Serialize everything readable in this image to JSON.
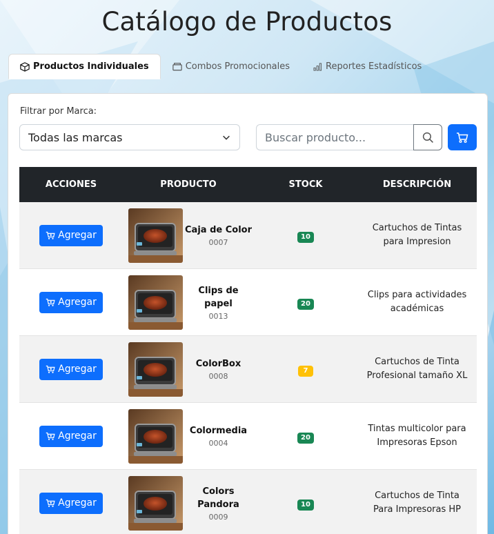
{
  "page": {
    "title": "Catálogo de Productos"
  },
  "tabs": [
    {
      "label": "Productos Individuales",
      "icon": "box-icon",
      "active": true
    },
    {
      "label": "Combos Promocionales",
      "icon": "gift-box-icon",
      "active": false
    },
    {
      "label": "Reportes Estadísticos",
      "icon": "bar-chart-icon",
      "active": false
    }
  ],
  "filter": {
    "label": "Filtrar por Marca:",
    "selected": "Todas las marcas"
  },
  "search": {
    "placeholder": "Buscar producto...",
    "value": ""
  },
  "table": {
    "headers": {
      "actions": "ACCIONES",
      "product": "PRODUCTO",
      "stock": "STOCK",
      "description": "DESCRIPCIÓN"
    },
    "rows": [
      {
        "action": "Agregar",
        "name": "Caja de Color",
        "code": "0007",
        "stock": "10",
        "stock_color": "#198754",
        "description": "Cartuchos de Tintas para Impresion"
      },
      {
        "action": "Agregar",
        "name": "Clips de papel",
        "code": "0013",
        "stock": "20",
        "stock_color": "#198754",
        "description": "Clips para actividades académicas"
      },
      {
        "action": "Agregar",
        "name": "ColorBox",
        "code": "0008",
        "stock": "7",
        "stock_color": "#ffc107",
        "description": "Cartuchos de Tinta Profesional tamaño XL"
      },
      {
        "action": "Agregar",
        "name": "Colormedia",
        "code": "0004",
        "stock": "20",
        "stock_color": "#198754",
        "description": "Tintas multicolor para Impresoras Epson"
      },
      {
        "action": "Agregar",
        "name": "Colors Pandora",
        "code": "0009",
        "stock": "10",
        "stock_color": "#198754",
        "description": "Cartuchos de Tinta Para Impresoras HP"
      }
    ]
  },
  "colors": {
    "primary": "#0d6efd",
    "table_header": "#212529",
    "stock_ok": "#198754",
    "stock_low": "#ffc107"
  }
}
